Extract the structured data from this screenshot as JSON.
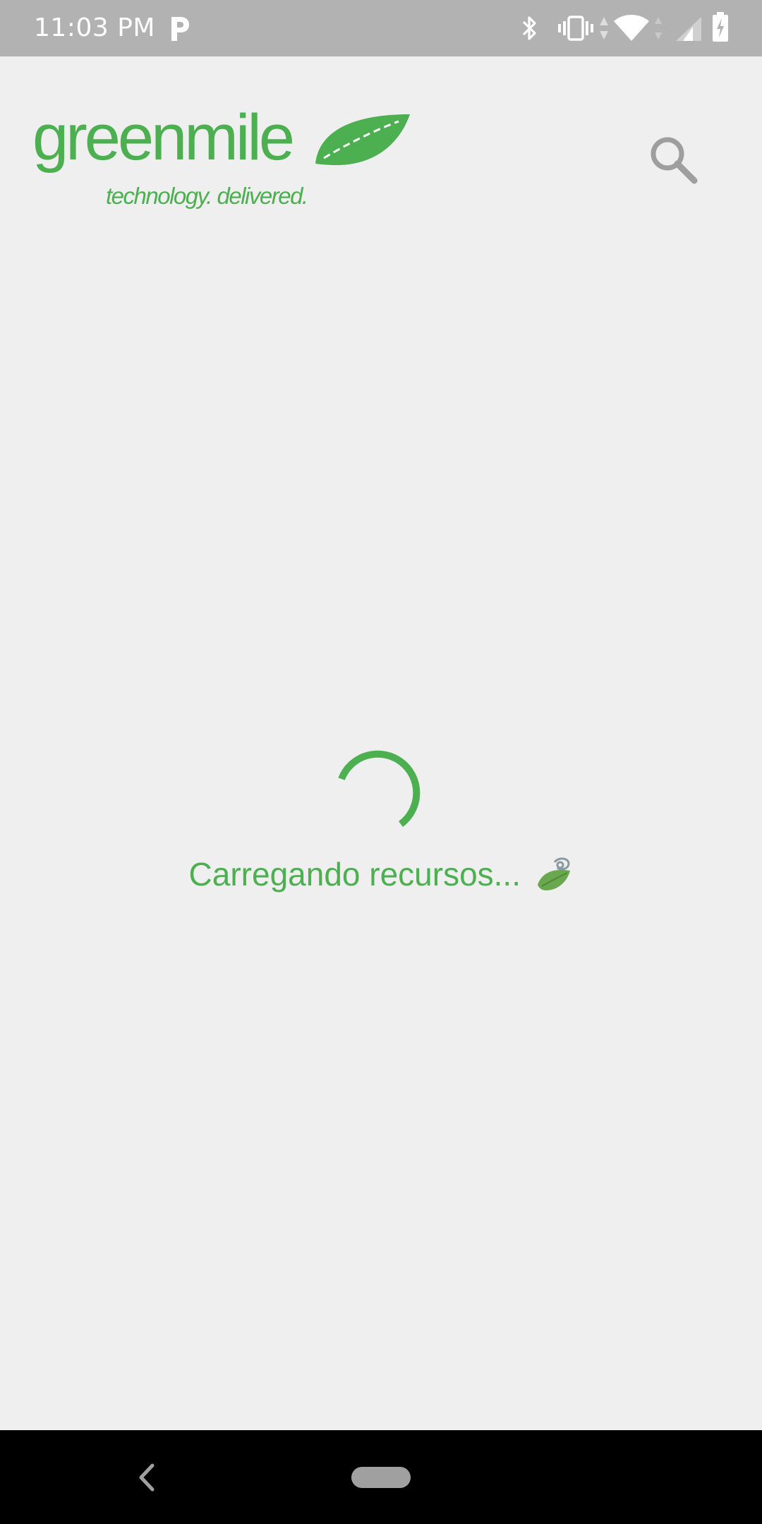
{
  "status_bar": {
    "time": "11:03 PM",
    "notification_icon": "parking-p-icon",
    "icons": [
      "bluetooth-icon",
      "vibrate-icon",
      "data-arrows-icon",
      "wifi-icon",
      "signal-icon",
      "battery-charging-icon"
    ]
  },
  "header": {
    "logo_word": "greenmile",
    "logo_tagline": "technology. delivered.",
    "search_icon": "search-icon"
  },
  "loading": {
    "message": "Carregando recursos...",
    "icon": "leaf-loading-icon"
  },
  "nav_bar": {
    "back_icon": "back-chevron-icon",
    "home_icon": "home-pill-icon"
  },
  "colors": {
    "accent": "#4caf50",
    "status_bar": "#b2b2b2",
    "background": "#efefef",
    "nav_bar": "#000000",
    "icon_gray": "#9e9e9e"
  }
}
